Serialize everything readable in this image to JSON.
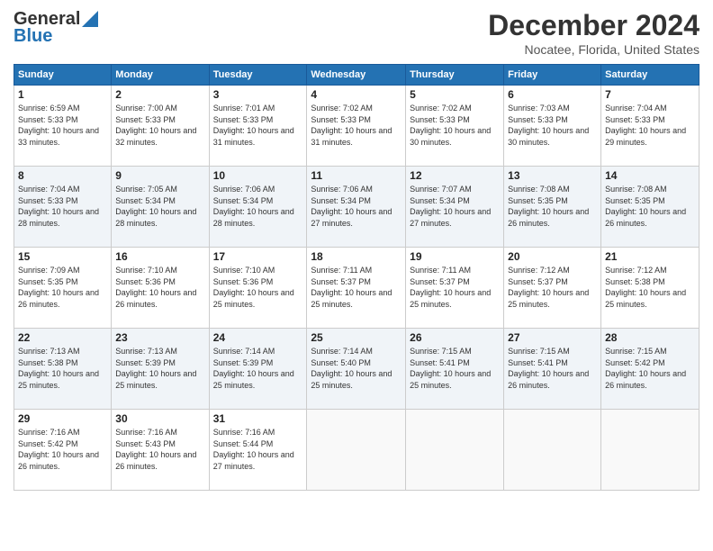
{
  "logo": {
    "line1": "General",
    "line2": "Blue"
  },
  "header": {
    "month": "December 2024",
    "location": "Nocatee, Florida, United States"
  },
  "weekdays": [
    "Sunday",
    "Monday",
    "Tuesday",
    "Wednesday",
    "Thursday",
    "Friday",
    "Saturday"
  ],
  "weeks": [
    [
      {
        "day": "1",
        "sunrise": "Sunrise: 6:59 AM",
        "sunset": "Sunset: 5:33 PM",
        "daylight": "Daylight: 10 hours and 33 minutes."
      },
      {
        "day": "2",
        "sunrise": "Sunrise: 7:00 AM",
        "sunset": "Sunset: 5:33 PM",
        "daylight": "Daylight: 10 hours and 32 minutes."
      },
      {
        "day": "3",
        "sunrise": "Sunrise: 7:01 AM",
        "sunset": "Sunset: 5:33 PM",
        "daylight": "Daylight: 10 hours and 31 minutes."
      },
      {
        "day": "4",
        "sunrise": "Sunrise: 7:02 AM",
        "sunset": "Sunset: 5:33 PM",
        "daylight": "Daylight: 10 hours and 31 minutes."
      },
      {
        "day": "5",
        "sunrise": "Sunrise: 7:02 AM",
        "sunset": "Sunset: 5:33 PM",
        "daylight": "Daylight: 10 hours and 30 minutes."
      },
      {
        "day": "6",
        "sunrise": "Sunrise: 7:03 AM",
        "sunset": "Sunset: 5:33 PM",
        "daylight": "Daylight: 10 hours and 30 minutes."
      },
      {
        "day": "7",
        "sunrise": "Sunrise: 7:04 AM",
        "sunset": "Sunset: 5:33 PM",
        "daylight": "Daylight: 10 hours and 29 minutes."
      }
    ],
    [
      {
        "day": "8",
        "sunrise": "Sunrise: 7:04 AM",
        "sunset": "Sunset: 5:33 PM",
        "daylight": "Daylight: 10 hours and 28 minutes."
      },
      {
        "day": "9",
        "sunrise": "Sunrise: 7:05 AM",
        "sunset": "Sunset: 5:34 PM",
        "daylight": "Daylight: 10 hours and 28 minutes."
      },
      {
        "day": "10",
        "sunrise": "Sunrise: 7:06 AM",
        "sunset": "Sunset: 5:34 PM",
        "daylight": "Daylight: 10 hours and 28 minutes."
      },
      {
        "day": "11",
        "sunrise": "Sunrise: 7:06 AM",
        "sunset": "Sunset: 5:34 PM",
        "daylight": "Daylight: 10 hours and 27 minutes."
      },
      {
        "day": "12",
        "sunrise": "Sunrise: 7:07 AM",
        "sunset": "Sunset: 5:34 PM",
        "daylight": "Daylight: 10 hours and 27 minutes."
      },
      {
        "day": "13",
        "sunrise": "Sunrise: 7:08 AM",
        "sunset": "Sunset: 5:35 PM",
        "daylight": "Daylight: 10 hours and 26 minutes."
      },
      {
        "day": "14",
        "sunrise": "Sunrise: 7:08 AM",
        "sunset": "Sunset: 5:35 PM",
        "daylight": "Daylight: 10 hours and 26 minutes."
      }
    ],
    [
      {
        "day": "15",
        "sunrise": "Sunrise: 7:09 AM",
        "sunset": "Sunset: 5:35 PM",
        "daylight": "Daylight: 10 hours and 26 minutes."
      },
      {
        "day": "16",
        "sunrise": "Sunrise: 7:10 AM",
        "sunset": "Sunset: 5:36 PM",
        "daylight": "Daylight: 10 hours and 26 minutes."
      },
      {
        "day": "17",
        "sunrise": "Sunrise: 7:10 AM",
        "sunset": "Sunset: 5:36 PM",
        "daylight": "Daylight: 10 hours and 25 minutes."
      },
      {
        "day": "18",
        "sunrise": "Sunrise: 7:11 AM",
        "sunset": "Sunset: 5:37 PM",
        "daylight": "Daylight: 10 hours and 25 minutes."
      },
      {
        "day": "19",
        "sunrise": "Sunrise: 7:11 AM",
        "sunset": "Sunset: 5:37 PM",
        "daylight": "Daylight: 10 hours and 25 minutes."
      },
      {
        "day": "20",
        "sunrise": "Sunrise: 7:12 AM",
        "sunset": "Sunset: 5:37 PM",
        "daylight": "Daylight: 10 hours and 25 minutes."
      },
      {
        "day": "21",
        "sunrise": "Sunrise: 7:12 AM",
        "sunset": "Sunset: 5:38 PM",
        "daylight": "Daylight: 10 hours and 25 minutes."
      }
    ],
    [
      {
        "day": "22",
        "sunrise": "Sunrise: 7:13 AM",
        "sunset": "Sunset: 5:38 PM",
        "daylight": "Daylight: 10 hours and 25 minutes."
      },
      {
        "day": "23",
        "sunrise": "Sunrise: 7:13 AM",
        "sunset": "Sunset: 5:39 PM",
        "daylight": "Daylight: 10 hours and 25 minutes."
      },
      {
        "day": "24",
        "sunrise": "Sunrise: 7:14 AM",
        "sunset": "Sunset: 5:39 PM",
        "daylight": "Daylight: 10 hours and 25 minutes."
      },
      {
        "day": "25",
        "sunrise": "Sunrise: 7:14 AM",
        "sunset": "Sunset: 5:40 PM",
        "daylight": "Daylight: 10 hours and 25 minutes."
      },
      {
        "day": "26",
        "sunrise": "Sunrise: 7:15 AM",
        "sunset": "Sunset: 5:41 PM",
        "daylight": "Daylight: 10 hours and 25 minutes."
      },
      {
        "day": "27",
        "sunrise": "Sunrise: 7:15 AM",
        "sunset": "Sunset: 5:41 PM",
        "daylight": "Daylight: 10 hours and 26 minutes."
      },
      {
        "day": "28",
        "sunrise": "Sunrise: 7:15 AM",
        "sunset": "Sunset: 5:42 PM",
        "daylight": "Daylight: 10 hours and 26 minutes."
      }
    ],
    [
      {
        "day": "29",
        "sunrise": "Sunrise: 7:16 AM",
        "sunset": "Sunset: 5:42 PM",
        "daylight": "Daylight: 10 hours and 26 minutes."
      },
      {
        "day": "30",
        "sunrise": "Sunrise: 7:16 AM",
        "sunset": "Sunset: 5:43 PM",
        "daylight": "Daylight: 10 hours and 26 minutes."
      },
      {
        "day": "31",
        "sunrise": "Sunrise: 7:16 AM",
        "sunset": "Sunset: 5:44 PM",
        "daylight": "Daylight: 10 hours and 27 minutes."
      },
      null,
      null,
      null,
      null
    ]
  ]
}
